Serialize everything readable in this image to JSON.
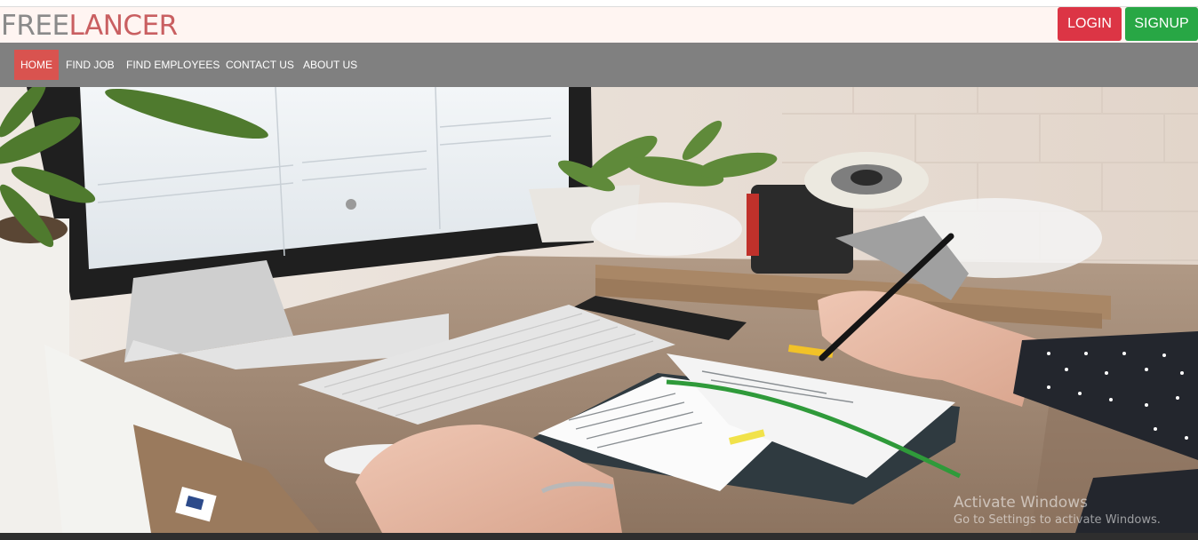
{
  "header": {
    "brand_part1": "FREE",
    "brand_part2": "LANCER",
    "login_label": "LOGIN",
    "signup_label": "SIGNUP"
  },
  "nav": {
    "items": [
      {
        "label": "HOME",
        "active": true
      },
      {
        "label": "FIND JOB"
      },
      {
        "label": "FIND EMPLOYEES"
      },
      {
        "label": "CONTACT US"
      },
      {
        "label": "ABOUT US"
      }
    ]
  },
  "hero": {
    "image": "workspace photo: desk with computer monitor, keyboard, phone, open notebook, hand writing with pen, tape dispenser, potted plants"
  },
  "watermark": {
    "title": "Activate Windows",
    "subtitle": "Go to Settings to activate Windows."
  },
  "colors": {
    "topbar_bg": "#fff5f2",
    "brand_gray": "#8a8a8a",
    "brand_red": "#c95f61",
    "login_bg": "#dc3545",
    "signup_bg": "#28a745",
    "navbar_bg": "#808080",
    "nav_active_bg": "#d9534f"
  }
}
